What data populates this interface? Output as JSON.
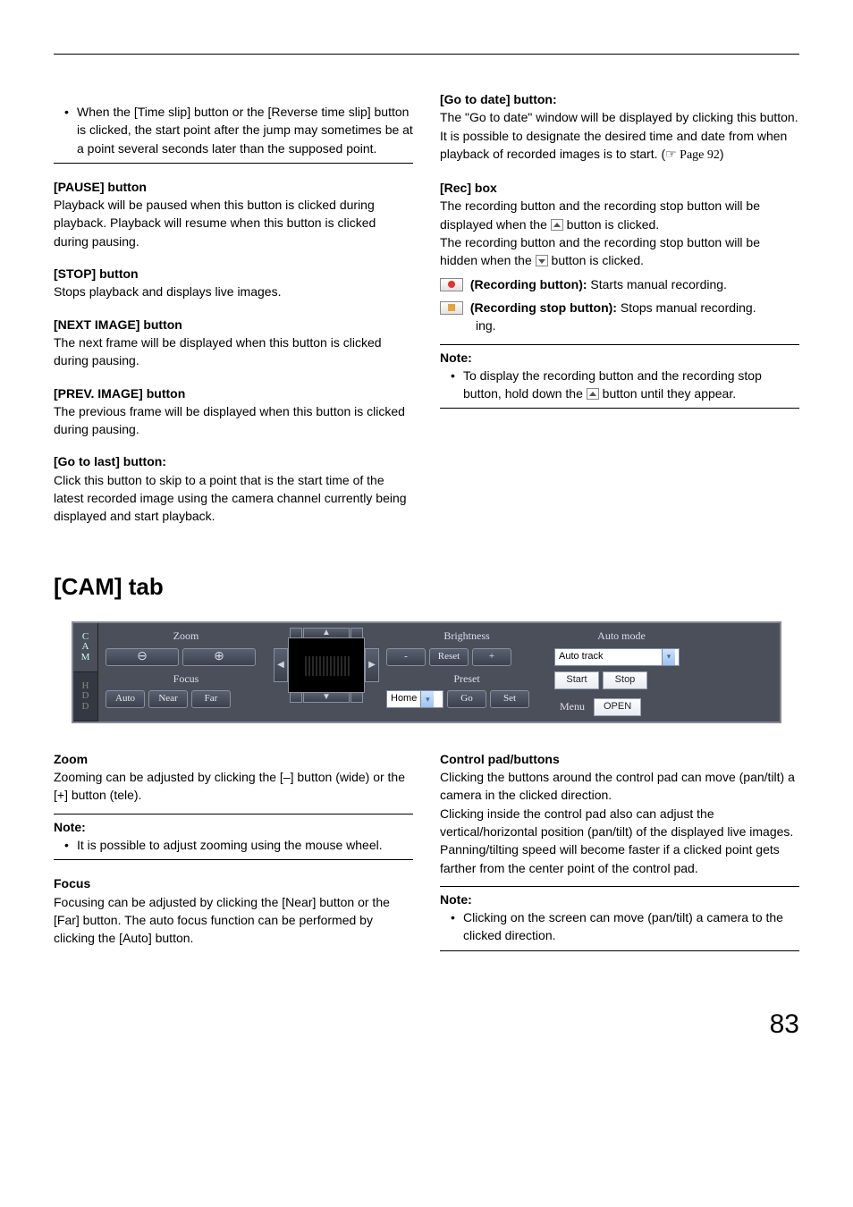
{
  "col1": {
    "bullet1": "When the [Time slip] button or the [Reverse time slip] button is clicked, the start point after the jump may sometimes be at a point several seconds later than the supposed point.",
    "pause_h": "[PAUSE] button",
    "pause_t": "Playback will be paused when this button is clicked during playback. Playback will resume when this button is clicked during pausing.",
    "stop_h": "[STOP] button",
    "stop_t": "Stops playback and displays live images.",
    "next_h": "[NEXT IMAGE] button",
    "next_t": "The next frame will be displayed when this button is clicked during pausing.",
    "prev_h": "[PREV. IMAGE] button",
    "prev_t": "The previous frame will be displayed when this button is clicked during pausing.",
    "gotolast_h": "[Go to last] button:",
    "gotolast_t": "Click this button to skip to a point that is the start time of the latest recorded image using the camera channel currently being displayed and start playback."
  },
  "col2": {
    "gotodate_h": "[Go to date] button:",
    "gotodate_t1": "The \"Go to date\" window will be displayed by clicking this button. It is possible to designate the desired time and date from when playback of recorded images is to start. (",
    "gotodate_ref": "☞ Page 92",
    "gotodate_t2": ")",
    "rec_h": "[Rec] box",
    "rec_t1a": "The recording button and the recording stop button will be displayed when the ",
    "rec_t1b": " button is clicked.",
    "rec_t2a": "The recording button and the recording stop button will be hidden when the ",
    "rec_t2b": " button is clicked.",
    "recbtn_term": " (Recording button):",
    "recbtn_text": " Starts manual recording.",
    "recstop_term": " (Recording stop button):",
    "recstop_text": " Stops manual recording.",
    "note_h": "Note:",
    "note_b_a": "To display the recording button and the recording stop button, hold down the ",
    "note_b_b": " button until they appear."
  },
  "section": "[CAM] tab",
  "cam": {
    "tab_cam": "C\nA\nM",
    "tab_hdd": "H\nD\nD",
    "zoom": "Zoom",
    "focus": "Focus",
    "auto": "Auto",
    "near": "Near",
    "far": "Far",
    "brightness": "Brightness",
    "reset": "Reset",
    "minus": "-",
    "plus": "+",
    "preset": "Preset",
    "preset_sel": "Home",
    "go": "Go",
    "set": "Set",
    "automode": "Auto mode",
    "automode_sel": "Auto track",
    "start": "Start",
    "stop": "Stop",
    "menu": "Menu",
    "open": "OPEN"
  },
  "lower": {
    "zoom_h": "Zoom",
    "zoom_t": "Zooming can be adjusted by clicking the [–] button (wide) or the [+] button (tele).",
    "note1_h": "Note:",
    "note1_b": "It is possible to adjust zooming using the mouse wheel.",
    "focus_h": "Focus",
    "focus_t": "Focusing can be adjusted by clicking the [Near] button or the [Far] button. The auto focus function can be performed by clicking the [Auto] button.",
    "cpad_h": "Control pad/buttons",
    "cpad_t": "Clicking the buttons around the control pad can move (pan/tilt) a camera in the clicked direction.\nClicking inside the control pad also can adjust the vertical/horizontal position (pan/tilt) of the displayed live images. Panning/tilting speed will become faster if a clicked point gets farther from the center point of the control pad.",
    "note2_h": "Note:",
    "note2_b": "Clicking on the screen can move (pan/tilt) a camera to the clicked direction."
  },
  "pagenum": "83"
}
